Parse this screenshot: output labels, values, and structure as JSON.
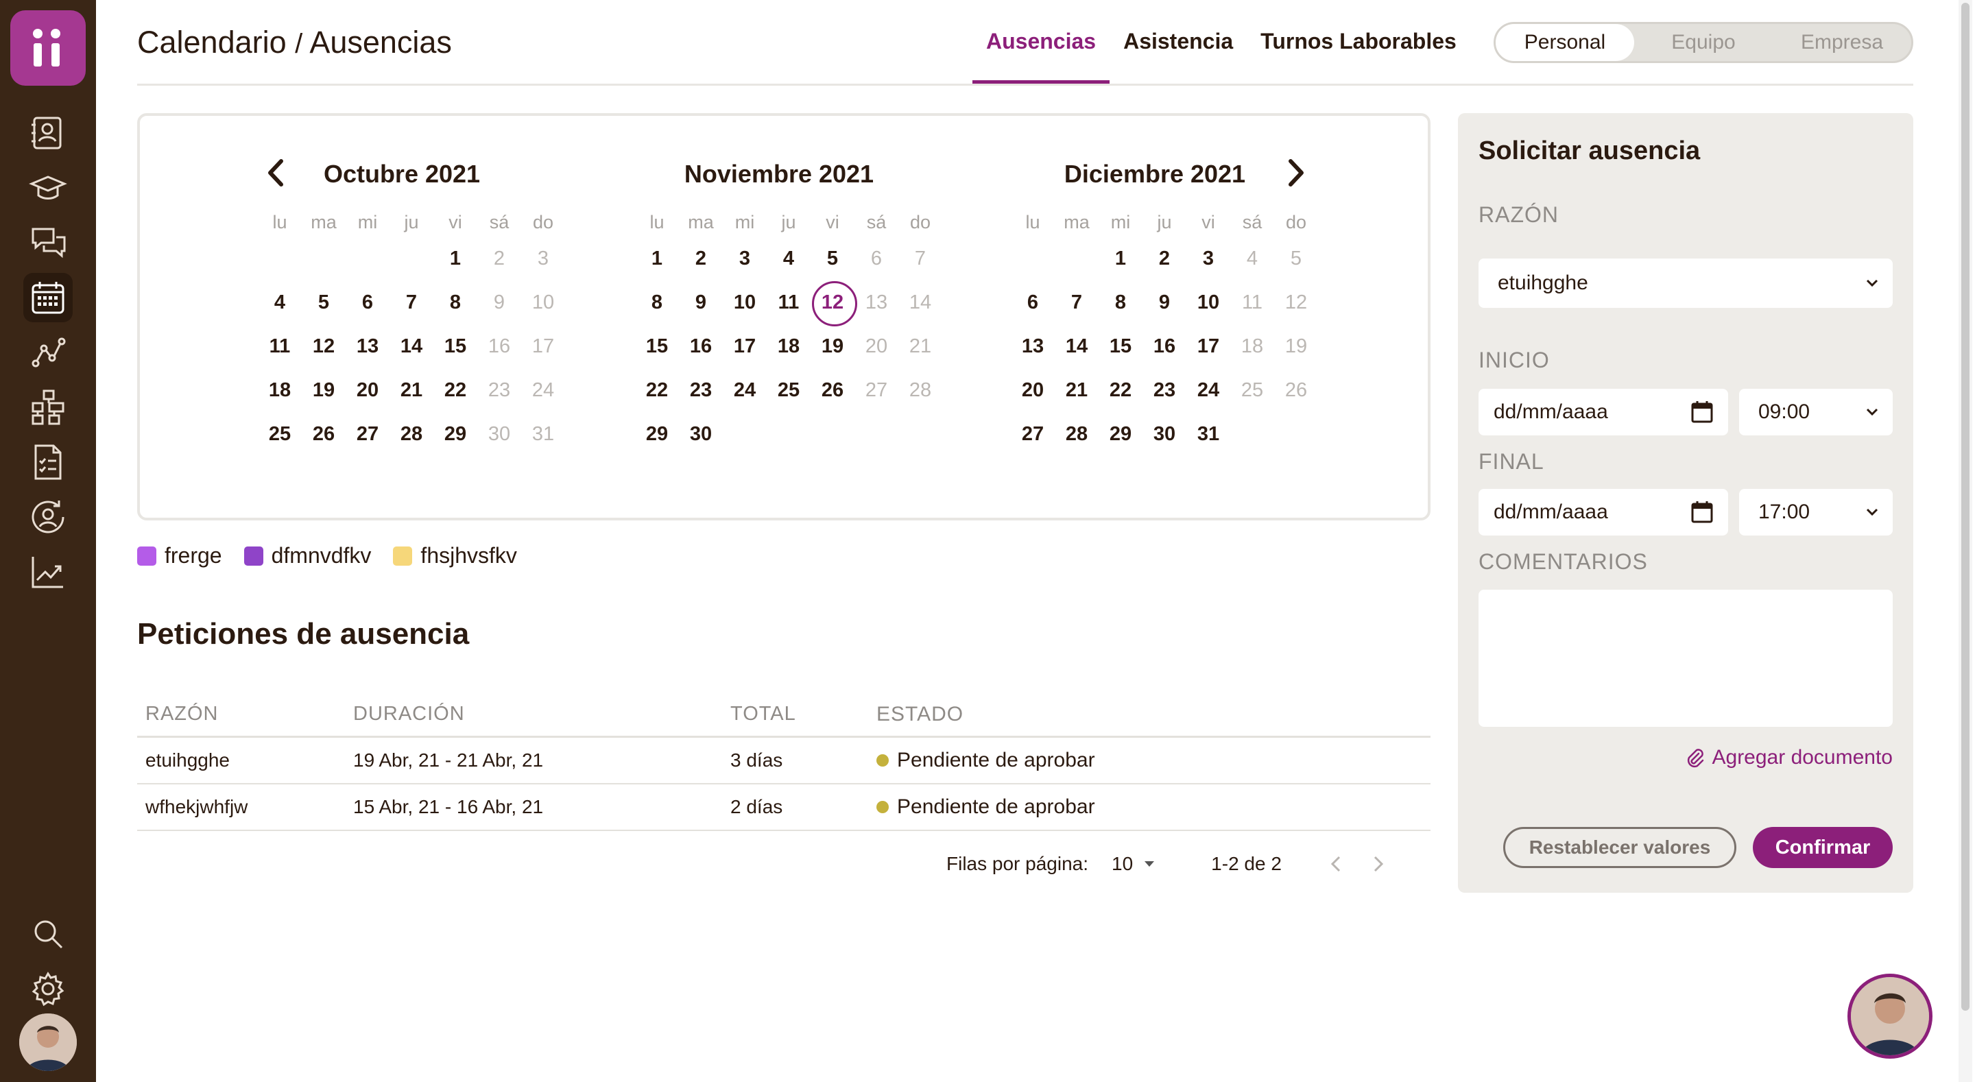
{
  "header": {
    "title_part1": "Calendario",
    "title_sep": "/",
    "title_part2": "Ausencias",
    "tabs": [
      "Ausencias",
      "Asistencia",
      "Turnos Laborables"
    ],
    "scope": [
      "Personal",
      "Equipo",
      "Empresa"
    ]
  },
  "calendar": {
    "weekdays": [
      "lu",
      "ma",
      "mi",
      "ju",
      "vi",
      "sá",
      "do"
    ],
    "months": [
      {
        "title": "Octubre 2021",
        "offset": 4,
        "days": 31
      },
      {
        "title": "Noviembre 2021",
        "offset": 0,
        "days": 30,
        "today": 12
      },
      {
        "title": "Diciembre 2021",
        "offset": 2,
        "days": 31
      }
    ]
  },
  "legend": [
    {
      "label": "frerge",
      "color": "#b45ce8"
    },
    {
      "label": "dfmnvdfkv",
      "color": "#8f44c8"
    },
    {
      "label": "fhsjhvsfkv",
      "color": "#f6d77a"
    }
  ],
  "requests": {
    "title": "Peticiones de ausencia",
    "columns": [
      "RAZÓN",
      "DURACIÓN",
      "TOTAL",
      "ESTADO"
    ],
    "rows": [
      {
        "reason": "etuihgghe",
        "duration": "19 Abr, 21 - 21 Abr, 21",
        "total": "3 días",
        "status": "Pendiente de aprobar"
      },
      {
        "reason": "wfhekjwhfjw",
        "duration": "15 Abr, 21 - 16 Abr, 21",
        "total": "2 días",
        "status": "Pendiente de aprobar"
      }
    ],
    "pager": {
      "label": "Filas por página:",
      "per_page": "10",
      "range": "1-2 de 2"
    }
  },
  "panel": {
    "title": "Solicitar ausencia",
    "reason_label": "RAZÓN",
    "reason_value": "etuihgghe",
    "start_label": "INICIO",
    "start_date": "dd/mm/aaaa",
    "start_time": "09:00",
    "end_label": "FINAL",
    "end_date": "dd/mm/aaaa",
    "end_time": "17:00",
    "comments_label": "COMENTARIOS",
    "attach": "Agregar documento",
    "reset": "Restablecer valores",
    "confirm": "Confirmar"
  },
  "colors": {
    "accent": "#8c1f7a",
    "sidebar": "#3a2616",
    "status_pending": "#c4b13c"
  }
}
